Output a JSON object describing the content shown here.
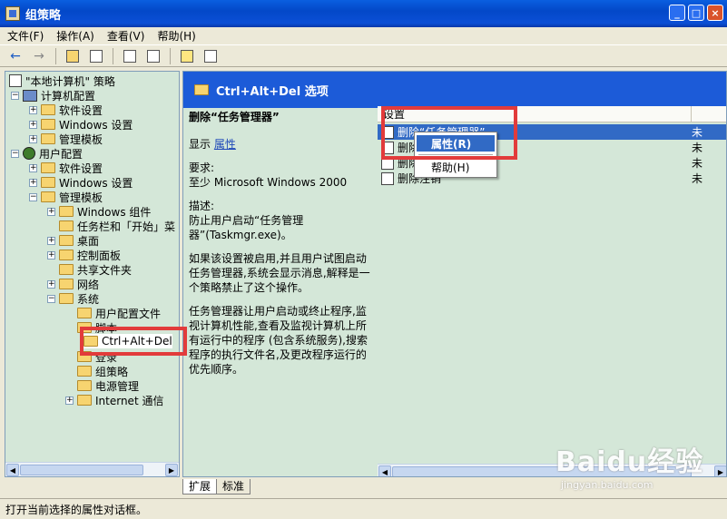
{
  "window": {
    "title": "组策略",
    "min": "_",
    "max": "□",
    "close": "×"
  },
  "menu": [
    "文件(F)",
    "操作(A)",
    "查看(V)",
    "帮助(H)"
  ],
  "tree": {
    "root": "\"本地计算机\" 策略",
    "items": [
      {
        "label": "计算机配置"
      },
      {
        "label": "软件设置"
      },
      {
        "label": "Windows 设置"
      },
      {
        "label": "管理模板"
      },
      {
        "label": "用户配置"
      },
      {
        "label": "软件设置"
      },
      {
        "label": "Windows 设置"
      },
      {
        "label": "管理模板"
      },
      {
        "label": "Windows 组件"
      },
      {
        "label": "任务栏和「开始」菜"
      },
      {
        "label": "桌面"
      },
      {
        "label": "控制面板"
      },
      {
        "label": "共享文件夹"
      },
      {
        "label": "网络"
      },
      {
        "label": "系统"
      },
      {
        "label": "用户配置文件"
      },
      {
        "label": "脚本"
      },
      {
        "label": "Ctrl+Alt+Del"
      },
      {
        "label": "登录"
      },
      {
        "label": "组策略"
      },
      {
        "label": "电源管理"
      },
      {
        "label": "Internet 通信"
      }
    ]
  },
  "right": {
    "header": "Ctrl+Alt+Del 选项",
    "desc": {
      "title": "删除“任务管理器”",
      "show_prefix": "显示",
      "show_link": "属性",
      "req_label": "要求:",
      "req_value": "至少 Microsoft Windows 2000",
      "desc_label": "描述:",
      "desc_p1": "防止用户启动“任务管理器”(Taskmgr.exe)。",
      "desc_p2": "如果该设置被启用,并且用户试图启动任务管理器,系统会显示消息,解释是一个策略禁止了这个操作。",
      "desc_p3": "任务管理器让用户启动或终止程序,监视计算机性能,查看及监视计算机上所有运行中的程序 (包含系统服务),搜索程序的执行文件名,及更改程序运行的优先顺序。"
    },
    "list": {
      "col_setting": "设置",
      "rows": [
        {
          "label": "删除“任务管理器”",
          "state": "未"
        },
        {
          "label": "删除",
          "state": "未"
        },
        {
          "label": "删除",
          "state": "未"
        },
        {
          "label": "删除注销",
          "state": "未"
        }
      ]
    }
  },
  "context_menu": {
    "properties": "属性(R)",
    "help": "帮助(H)"
  },
  "tabs": {
    "extended": "扩展",
    "standard": "标准"
  },
  "status": "打开当前选择的属性对话框。",
  "watermark": {
    "logo": "Baidu经验",
    "url": "jingyan.baidu.com"
  }
}
